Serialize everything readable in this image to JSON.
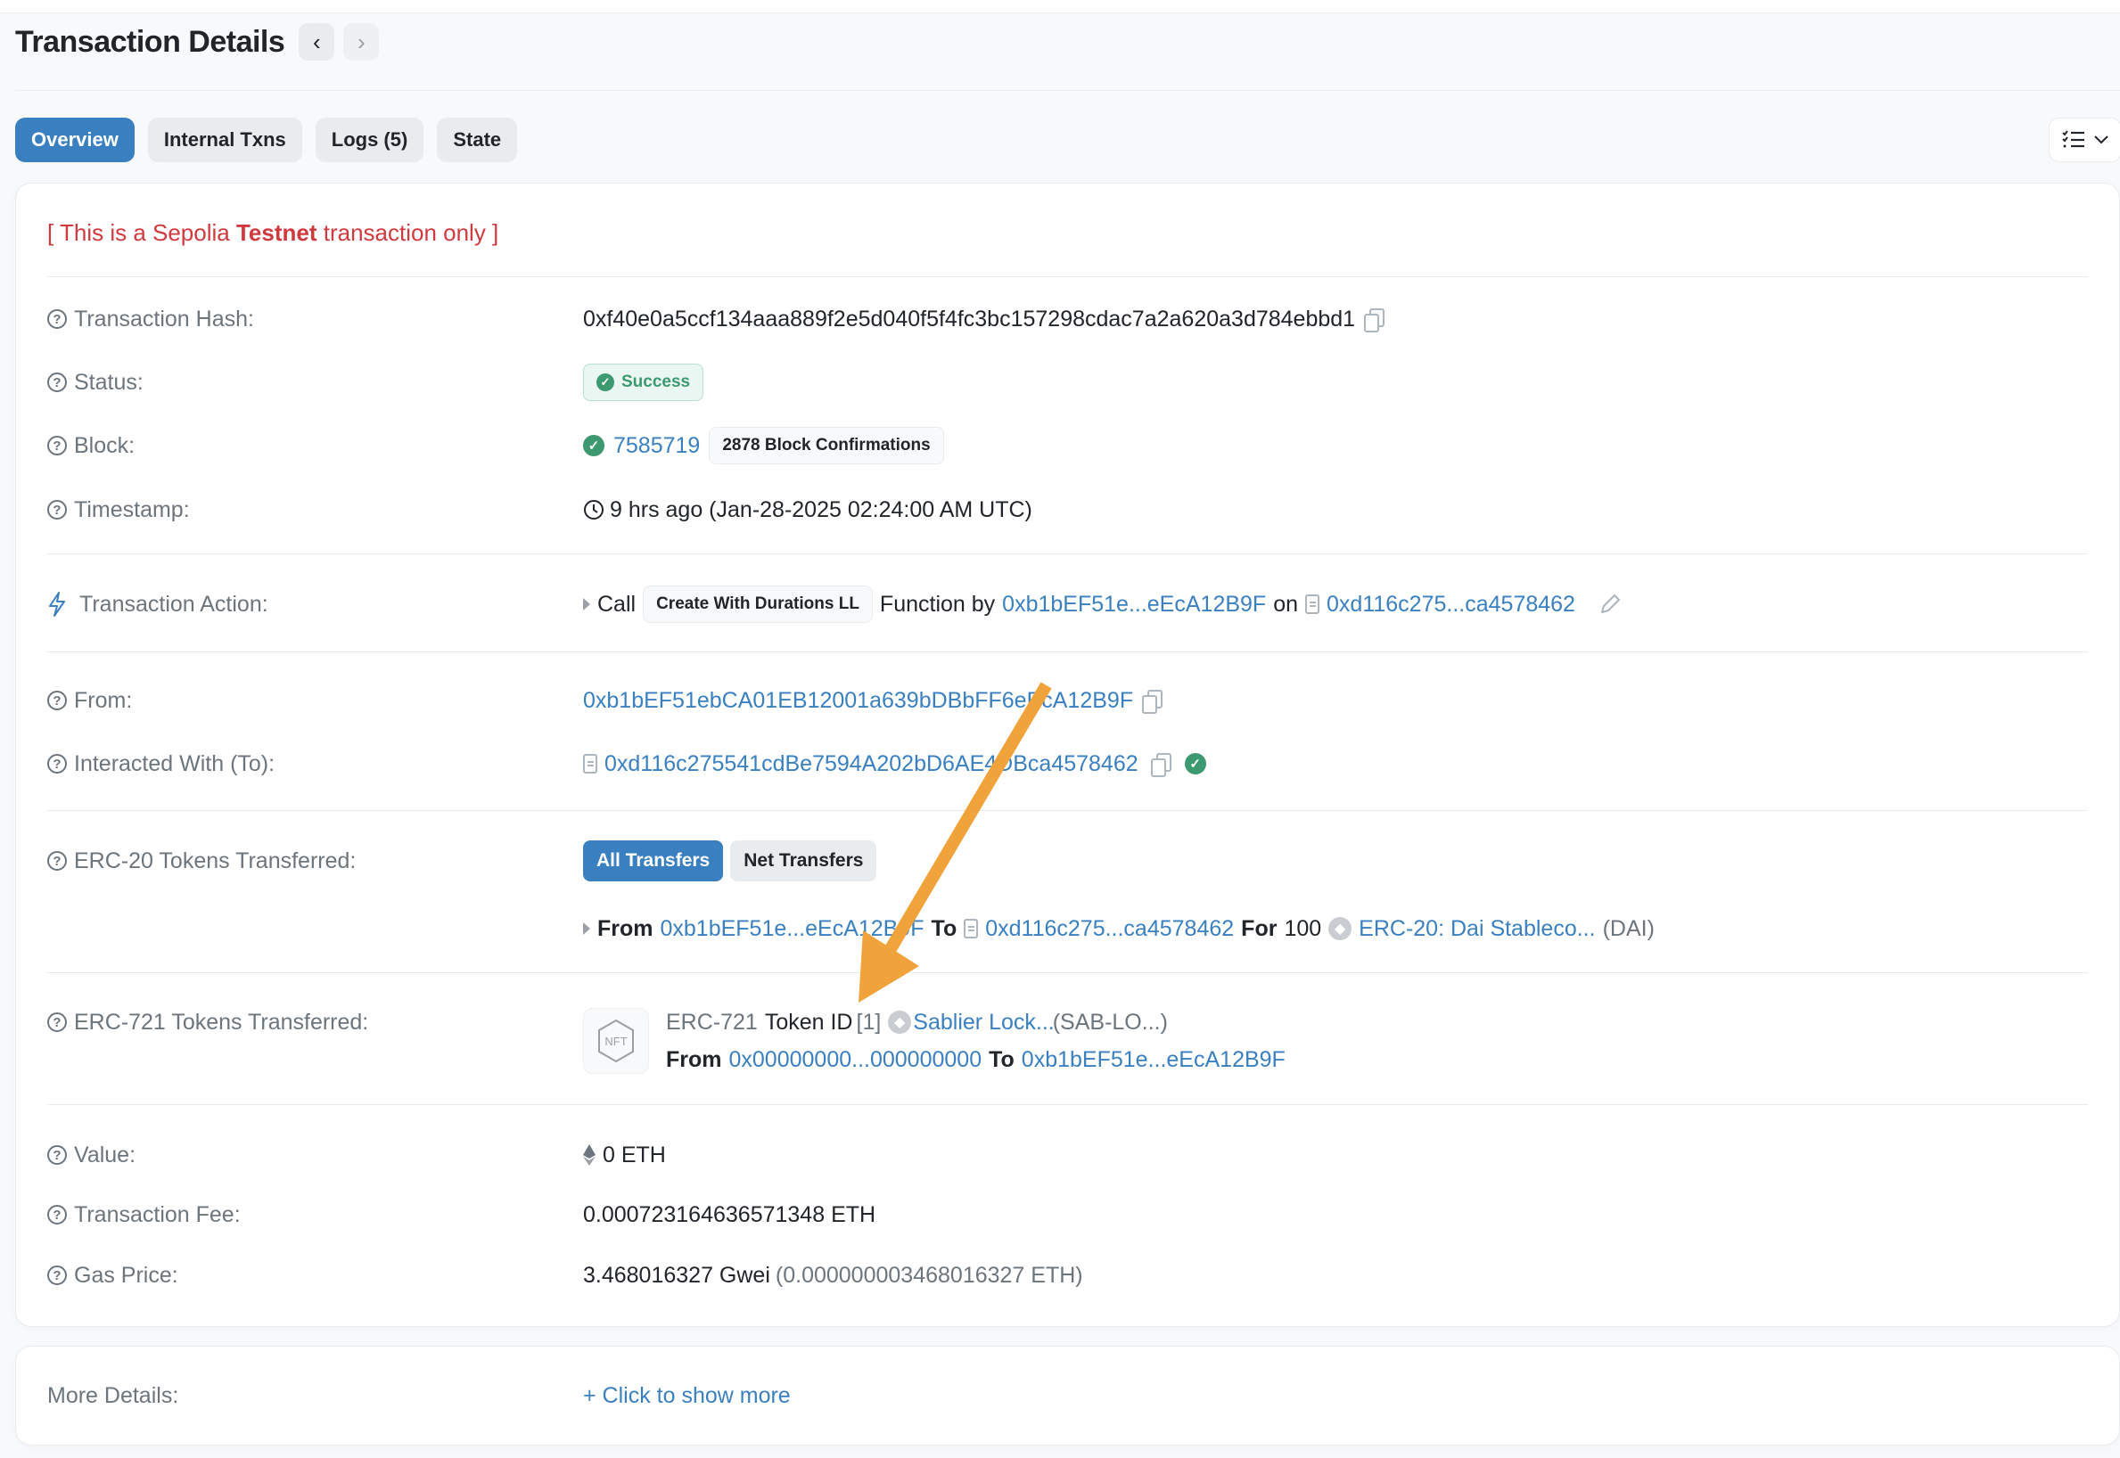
{
  "header": {
    "title": "Transaction Details",
    "prev_label": "‹",
    "next_label": "›"
  },
  "tabs": [
    {
      "label": "Overview",
      "active": true
    },
    {
      "label": "Internal Txns",
      "active": false
    },
    {
      "label": "Logs (5)",
      "active": false
    },
    {
      "label": "State",
      "active": false
    }
  ],
  "view_button": {
    "icon": "list-check-icon",
    "chevron": "⌄"
  },
  "testnet_notice": {
    "prefix": "[ This is a Sepolia ",
    "emphasis": "Testnet",
    "suffix": " transaction only ]"
  },
  "fields": {
    "tx_hash": {
      "label": "Transaction Hash:",
      "value": "0xf40e0a5ccf134aaa889f2e5d040f5f4fc3bc157298cdac7a2a620a3d784ebbd1"
    },
    "status": {
      "label": "Status:",
      "value": "Success"
    },
    "block": {
      "label": "Block:",
      "value": "7585719",
      "confirmations": "2878 Block Confirmations"
    },
    "timestamp": {
      "label": "Timestamp:",
      "value": "9 hrs ago (Jan-28-2025 02:24:00 AM UTC)"
    },
    "action": {
      "label": "Transaction Action:",
      "call": "Call",
      "method": "Create With Durations LL",
      "function_by": "Function by",
      "caller": "0xb1bEF51e...eEcA12B9F",
      "on": "on",
      "contract": "0xd116c275...ca4578462"
    },
    "from": {
      "label": "From:",
      "value": "0xb1bEF51ebCA01EB12001a639bDBbFF6eEcA12B9F"
    },
    "to": {
      "label": "Interacted With (To):",
      "value": "0xd116c275541cdBe7594A202bD6AE4DBca4578462"
    },
    "erc20": {
      "label": "ERC-20 Tokens Transferred:",
      "all_transfers": "All Transfers",
      "net_transfers": "Net Transfers",
      "from_word": "From",
      "from": "0xb1bEF51e...eEcA12B9F",
      "to_word": "To",
      "to": "0xd116c275...ca4578462",
      "for_word": "For",
      "amount": "100",
      "token": "ERC-20: Dai Stableco...",
      "symbol": "(DAI)"
    },
    "erc721": {
      "label": "ERC-721 Tokens Transferred:",
      "nft_badge": "NFT",
      "standard": "ERC-721",
      "token_id_label": "Token ID",
      "token_id": "[1]",
      "token": "Sablier Lock...",
      "symbol": "(SAB-LO...)",
      "from_word": "From",
      "from": "0x00000000...000000000",
      "to_word": "To",
      "to": "0xb1bEF51e...eEcA12B9F"
    },
    "value": {
      "label": "Value:",
      "value": "0 ETH"
    },
    "fee": {
      "label": "Transaction Fee:",
      "value": "0.000723164636571348 ETH"
    },
    "gas": {
      "label": "Gas Price:",
      "value": "3.468016327 Gwei",
      "eth": "(0.000000003468016327 ETH)"
    }
  },
  "more_details": {
    "label": "More Details:",
    "link": "+ Click to show more"
  },
  "colors": {
    "accent": "#3a80c1",
    "success": "#3d9970",
    "danger": "#d0393e",
    "annotation_arrow": "#f0a23b"
  }
}
